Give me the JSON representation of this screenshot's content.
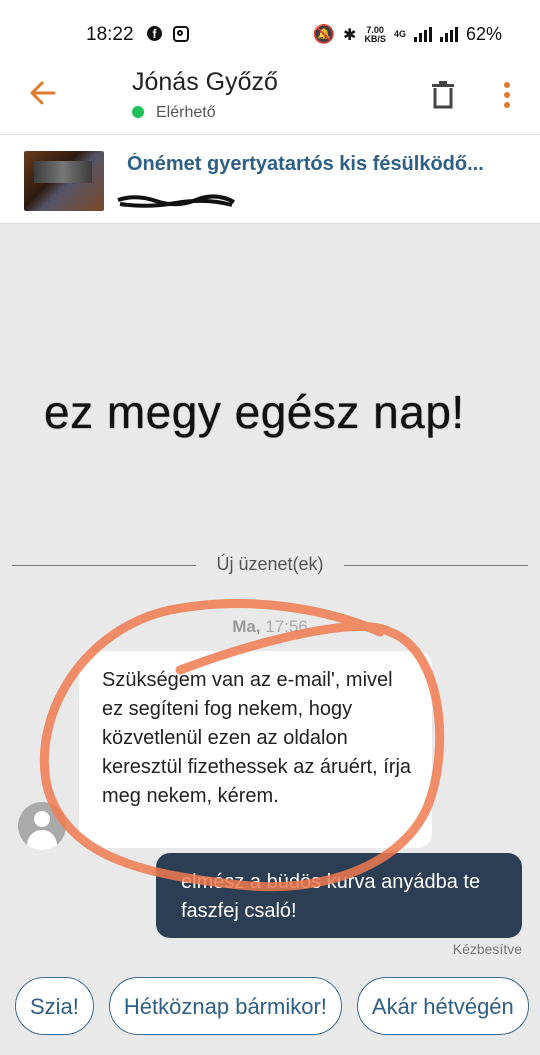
{
  "status_bar": {
    "time": "18:22",
    "speed_top": "7.00",
    "speed_unit": "KB/S",
    "network": "4G",
    "battery": "62%"
  },
  "header": {
    "name": "Jónás Győző",
    "status": "Elérhető",
    "accent_color": "#e07a2e",
    "online_color": "#1ec05a"
  },
  "listing": {
    "title": "Ónémet gyertyatartós kis fésülködő..."
  },
  "chat": {
    "overlay_text": "ez megy egész nap!",
    "new_messages_label": "Új üzenet(ek)",
    "date_day": "Ma,",
    "date_time": " 17:56",
    "incoming_message": "Szükségem van az e-mail', mivel ez segíteni fog nekem, hogy közvetlenül ezen az oldalon keresztül fizethessek az áruért, írja meg nekem, kérem.",
    "outgoing_message": "elmész a büdös kurva anyádba te faszfej csaló!",
    "delivered_label": "Kézbesítve",
    "outgoing_bubble_color": "#2b3e53"
  },
  "quick_replies": [
    "Szia!",
    "Hétköznap bármikor!",
    "Akár hétvégén"
  ]
}
